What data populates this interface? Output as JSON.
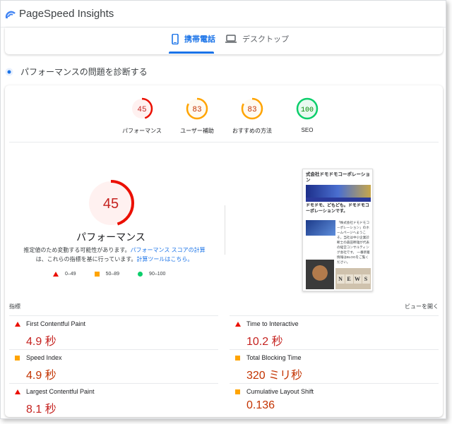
{
  "app": {
    "title": "PageSpeed Insights"
  },
  "tabs": [
    {
      "label": "携帯電話",
      "icon": "smartphone-icon",
      "active": true
    },
    {
      "label": "デスクトップ",
      "icon": "laptop-icon",
      "active": false
    }
  ],
  "diagnose": {
    "label": "パフォーマンスの問題を診断する"
  },
  "categories": [
    {
      "label": "パフォーマンス",
      "score": "45",
      "color": "#eb0f00",
      "fill": "#fff1f0",
      "fraction": 0.45
    },
    {
      "label": "ユーザー補助",
      "score": "83",
      "color": "#ffa400",
      "fill": "#fffaf0",
      "fraction": 0.83
    },
    {
      "label": "おすすめの方法",
      "score": "83",
      "color": "#ffa400",
      "fill": "#fffaf0",
      "fraction": 0.83
    },
    {
      "label": "SEO",
      "score": "100",
      "color": "#0cce6b",
      "fill": "#e8f9f0",
      "fraction": 1.0
    }
  ],
  "performance": {
    "score": "45",
    "label": "パフォーマンス",
    "note_before": "推定値のため変動する可能性があります。",
    "note_link1": "パフォーマンス スコアの計算",
    "note_middle": "は、これらの指標を基に行っています。",
    "note_link2": "計算ツールはこちら。",
    "fraction": 0.45
  },
  "legend": [
    {
      "range": "0–49",
      "shape": "triangle",
      "color": "#eb0f00"
    },
    {
      "range": "50–89",
      "shape": "square",
      "color": "#ffa400"
    },
    {
      "range": "90–100",
      "shape": "circle",
      "color": "#0cce6b"
    }
  ],
  "thumbnail": {
    "title": "式会社ドモドモコーポレーション",
    "headline": "ドモドモ、どもども。ドモドモコーポレーションです。",
    "body": "「株式会社ドモドモコーポレーション」のホームページへようこそ。当社は中小企業診断士の森田幹雄が代表の経営コンサルティング会社です。 一番新着情報はBLOGをご覧ください。",
    "news_letters": [
      "N",
      "E",
      "W",
      "S"
    ]
  },
  "metrics": {
    "heading": "指標",
    "expand_label": "ビューを開く",
    "items": [
      {
        "name": "First Contentful Paint",
        "value": "4.9 秒",
        "rating": "fail"
      },
      {
        "name": "Time to Interactive",
        "value": "10.2 秒",
        "rating": "fail"
      },
      {
        "name": "Speed Index",
        "value": "4.9 秒",
        "rating": "average"
      },
      {
        "name": "Total Blocking Time",
        "value": "320 ミリ秒",
        "rating": "average"
      },
      {
        "name": "Largest Contentful Paint",
        "value": "8.1 秒",
        "rating": "fail"
      },
      {
        "name": "Cumulative Layout Shift",
        "value": "0.136",
        "rating": "average"
      }
    ]
  }
}
